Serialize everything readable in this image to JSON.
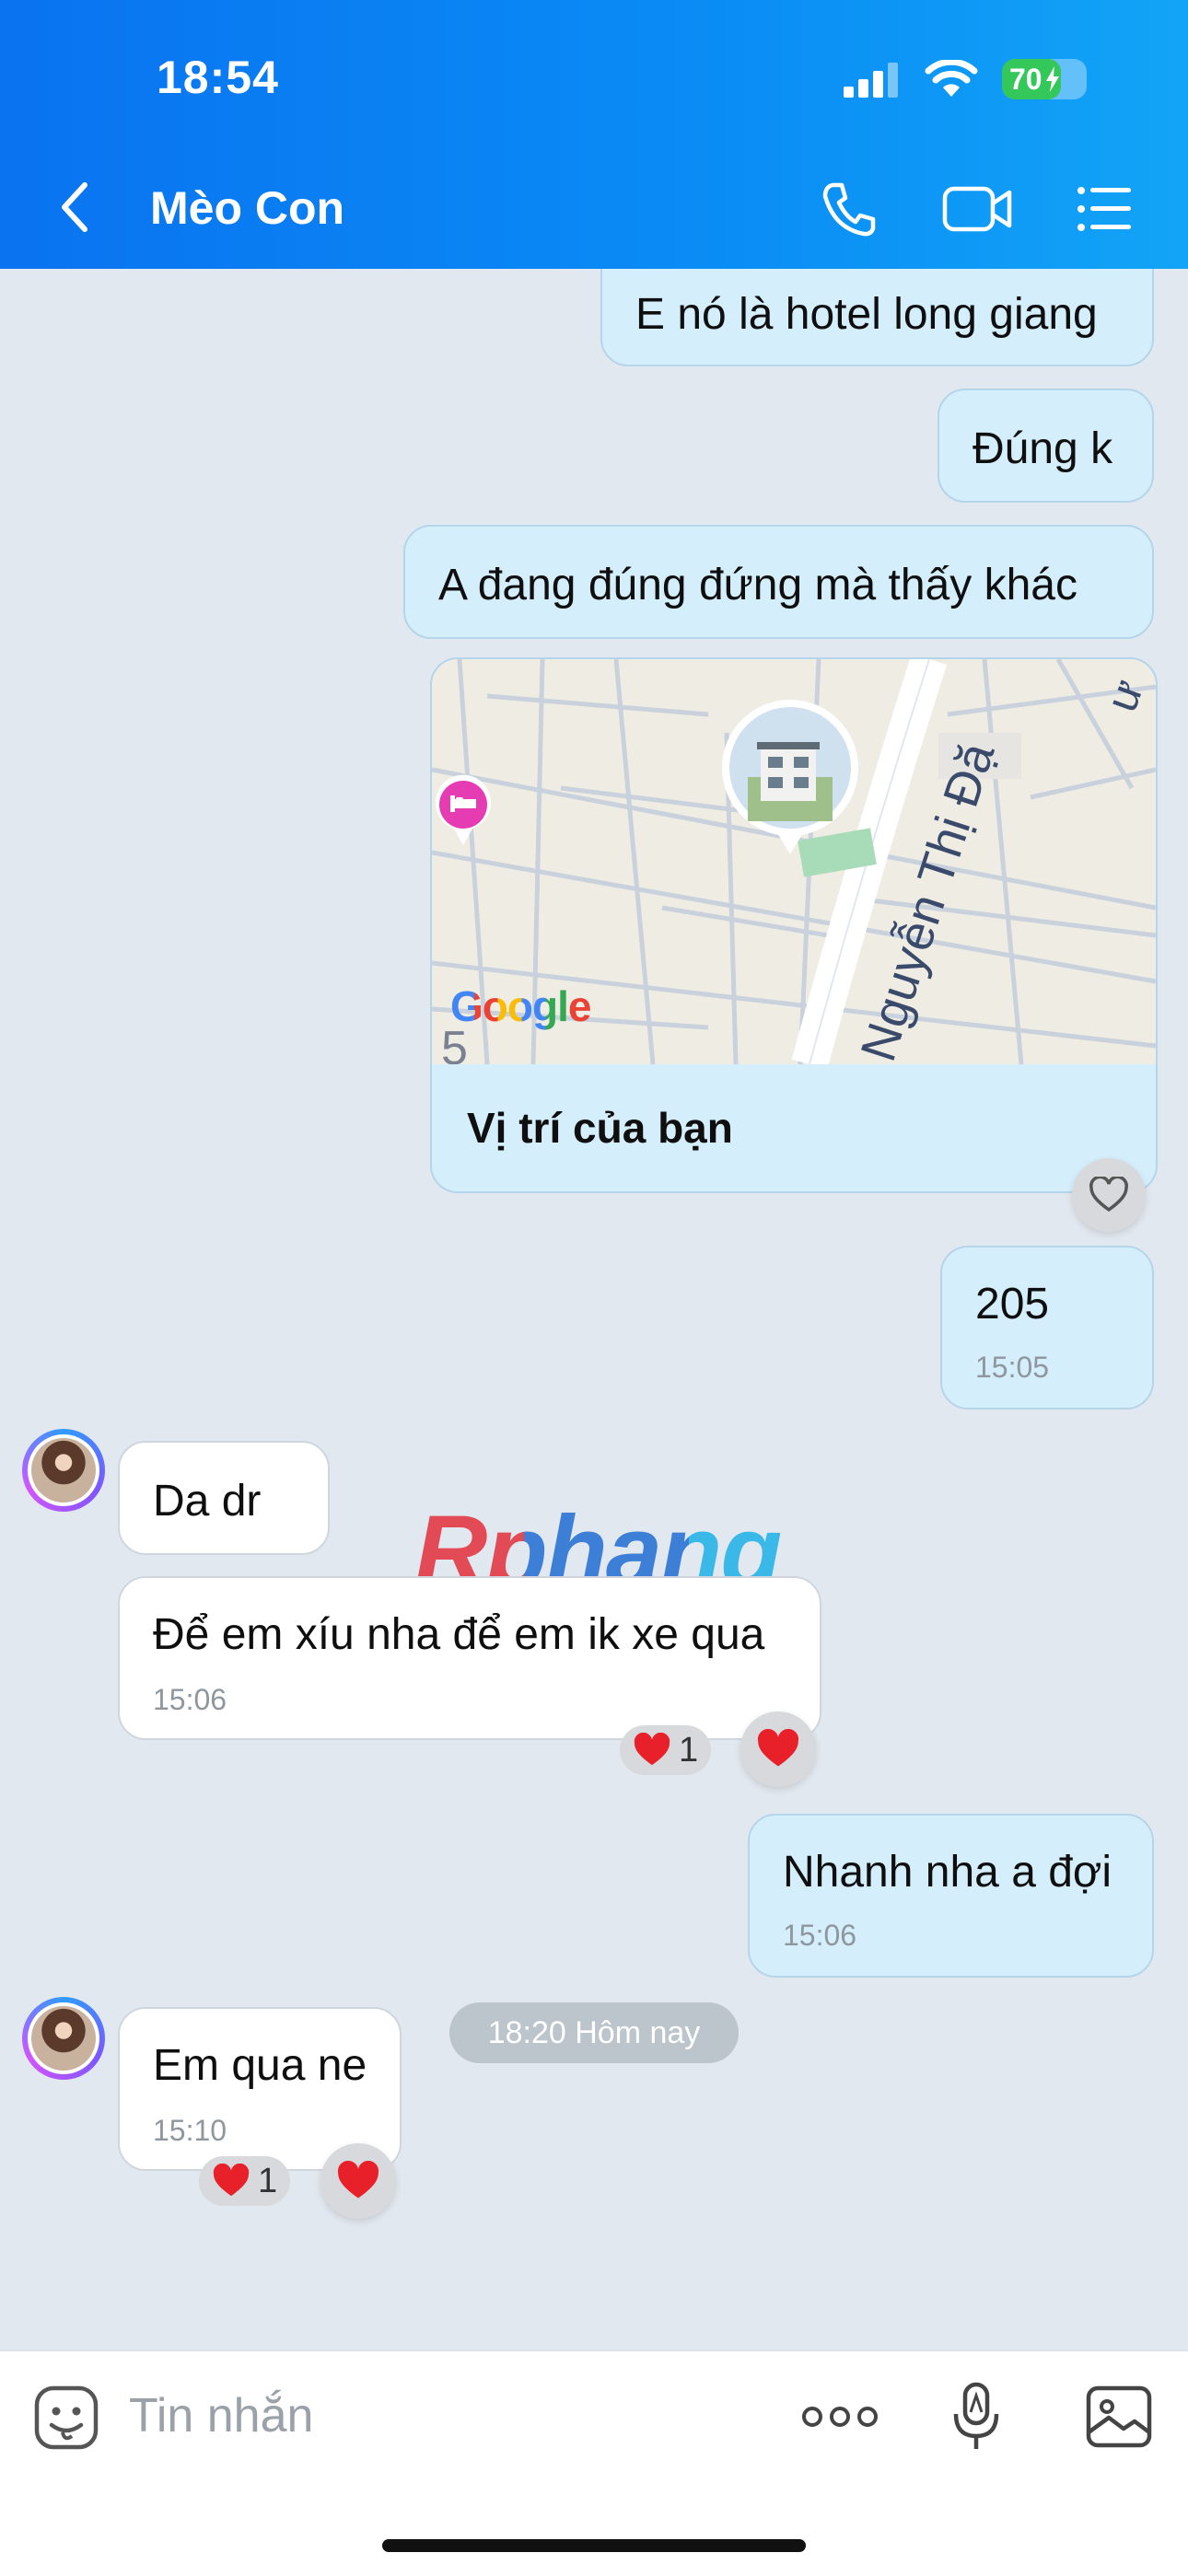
{
  "status_bar": {
    "time": "18:54",
    "battery": "70",
    "battery_level": 0.7
  },
  "header": {
    "title": "Mèo Con"
  },
  "messages": {
    "m1": {
      "text": "E nó là hotel long giang"
    },
    "m2": {
      "text": "Đúng k"
    },
    "m3": {
      "text": "A đang đúng đứng mà thấy khác"
    },
    "map": {
      "label": "Vị trí của bạn",
      "street": "Nguyễn Thị Đặ",
      "logo": "Google",
      "map_number": "5"
    },
    "m4": {
      "text": "205",
      "time": "15:05"
    },
    "m5": {
      "text": "Da dr"
    },
    "m6": {
      "text": "Để em xíu nha để em ik xe qua",
      "time": "15:06",
      "reaction_count": "1"
    },
    "m7": {
      "text": "Nhanh nha a đợi",
      "time": "15:06"
    },
    "m8": {
      "text": "Em qua ne",
      "time": "15:10",
      "reaction_count": "1"
    }
  },
  "date_chip": "18:20 Hôm nay",
  "watermark": "Rphang",
  "composer": {
    "placeholder": "Tin nhắn"
  },
  "icons": [
    "back-icon",
    "phone-icon",
    "video-call-icon",
    "menu-icon",
    "heart-icon",
    "sticker-icon",
    "more-icon",
    "voice-icon",
    "image-icon"
  ],
  "colors": {
    "header": "#0a80f3",
    "outgoing": "#d5eefc",
    "incoming": "#ffffff",
    "heart": "#e8202a"
  }
}
